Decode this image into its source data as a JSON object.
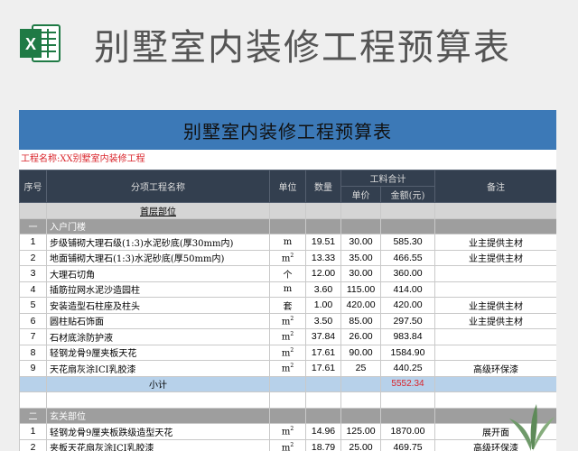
{
  "banner": {
    "title": "别墅室内装修工程预算表",
    "icon": "excel-icon"
  },
  "sheet": {
    "title": "别墅室内装修工程预算表",
    "project": "工程名称:XX别墅室内装修工程",
    "headers": {
      "seq": "序号",
      "item": "分项工程名称",
      "unit": "单位",
      "qty": "数量",
      "cost_group": "工料合计",
      "unit_price": "单价",
      "amount": "金额(元)",
      "remark": "备注"
    },
    "floor_label": "首层部位",
    "sections": [
      {
        "no": "一",
        "name": "入户门楼",
        "rows": [
          {
            "seq": "1",
            "name": "步级铺砌大理石级(1:3)水泥砂底(厚30mm内)",
            "unit": "m",
            "sup": "",
            "qty": "19.51",
            "price": "30.00",
            "amount": "585.30",
            "remark": "业主提供主材"
          },
          {
            "seq": "2",
            "name": "地面铺砌大理石(1:3)水泥砂底(厚50mm内)",
            "unit": "m",
            "sup": "2",
            "qty": "13.33",
            "price": "35.00",
            "amount": "466.55",
            "remark": "业主提供主材"
          },
          {
            "seq": "3",
            "name": "大理石切角",
            "unit": "个",
            "sup": "",
            "qty": "12.00",
            "price": "30.00",
            "amount": "360.00",
            "remark": ""
          },
          {
            "seq": "4",
            "name": "插筋拉网水泥沙造园柱",
            "unit": "m",
            "sup": "",
            "qty": "3.60",
            "price": "115.00",
            "amount": "414.00",
            "remark": ""
          },
          {
            "seq": "5",
            "name": "安装造型石柱座及柱头",
            "unit": "套",
            "sup": "",
            "qty": "1.00",
            "price": "420.00",
            "amount": "420.00",
            "remark": "业主提供主材"
          },
          {
            "seq": "6",
            "name": "圆柱贴石饰面",
            "unit": "m",
            "sup": "2",
            "qty": "3.50",
            "price": "85.00",
            "amount": "297.50",
            "remark": "业主提供主材"
          },
          {
            "seq": "7",
            "name": "石材底涂防护液",
            "unit": "m",
            "sup": "2",
            "qty": "37.84",
            "price": "26.00",
            "amount": "983.84",
            "remark": ""
          },
          {
            "seq": "8",
            "name": "轻钢龙骨9厘夹板天花",
            "unit": "m",
            "sup": "2",
            "qty": "17.61",
            "price": "90.00",
            "amount": "1584.90",
            "remark": ""
          },
          {
            "seq": "9",
            "name": "天花扇灰涂ICI乳胶漆",
            "unit": "m",
            "sup": "2",
            "qty": "17.61",
            "price": "25",
            "amount": "440.25",
            "remark": "高级环保漆"
          }
        ],
        "subtotal_label": "小计",
        "subtotal": "5552.34"
      },
      {
        "no": "二",
        "name": "玄关部位",
        "rows": [
          {
            "seq": "1",
            "name": "轻钢龙骨9厘夹板跌级造型天花",
            "unit": "m",
            "sup": "2",
            "qty": "14.96",
            "price": "125.00",
            "amount": "1870.00",
            "remark": "展开面"
          },
          {
            "seq": "2",
            "name": "夹板天花扇灰涂ICI乳胶漆",
            "unit": "m",
            "sup": "2",
            "qty": "18.79",
            "price": "25.00",
            "amount": "469.75",
            "remark": "高级环保漆"
          }
        ]
      }
    ]
  }
}
